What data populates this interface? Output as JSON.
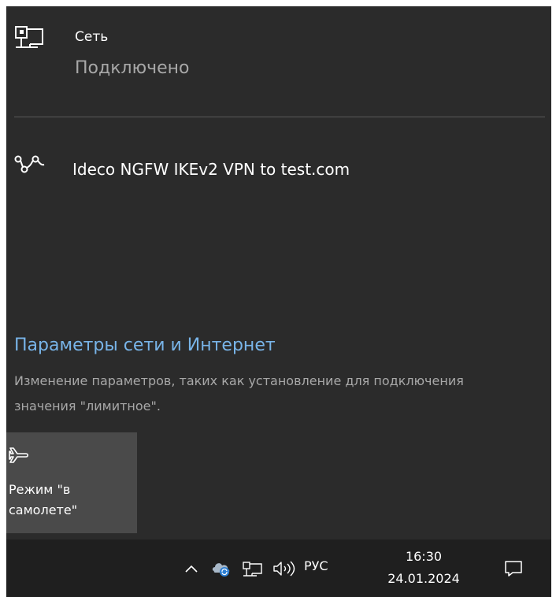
{
  "network": {
    "icon": "wired-network-icon",
    "title": "Сеть",
    "status": "Подключено"
  },
  "vpn": {
    "icon": "vpn-icon",
    "name": "Ideco NGFW IKEv2 VPN to test.com"
  },
  "settings": {
    "link_label": "Параметры сети и Интернет",
    "description": "Изменение параметров, таких как установление для подключения значения \"лимитное\"."
  },
  "quick_actions": {
    "airplane_mode": {
      "icon": "airplane-icon",
      "label": "Режим \"в самолете\""
    }
  },
  "taskbar": {
    "tray_icons": [
      "chevron-up-icon",
      "onedrive-sync-icon",
      "network-icon",
      "volume-icon"
    ],
    "language": "РУС",
    "time": "16:30",
    "date": "24.01.2024",
    "notification_icon": "action-center-icon"
  },
  "colors": {
    "panel_bg": "#2b2b2b",
    "taskbar_bg": "#1f1f1f",
    "tile_bg": "#4a4a4a",
    "link": "#78b4e8",
    "secondary_text": "#a8a8a8"
  }
}
